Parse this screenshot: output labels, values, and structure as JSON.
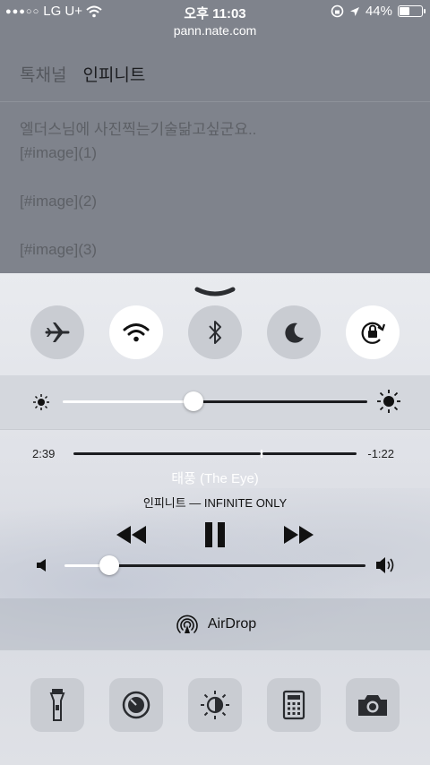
{
  "status_bar": {
    "carrier": "LG U+",
    "time": "오후 11:03",
    "battery_percent": "44%",
    "battery_level": 0.44
  },
  "browser": {
    "url": "pann.nate.com"
  },
  "background_page": {
    "nav": [
      "톡채널",
      "인피니트"
    ],
    "lines": [
      "엘더스님에 사진찍는기술닮고싶군요..",
      "[#image](1)",
      "[#image](2)",
      "[#image](3)"
    ]
  },
  "control_center": {
    "toggles": [
      {
        "icon": "airplane-icon",
        "on": false
      },
      {
        "icon": "wifi-icon",
        "on": true
      },
      {
        "icon": "bluetooth-icon",
        "on": false
      },
      {
        "icon": "moon-icon",
        "on": false
      },
      {
        "icon": "rotation-lock-icon",
        "on": true
      }
    ],
    "brightness_level": 0.43,
    "media": {
      "elapsed": "2:39",
      "remaining": "-1:22",
      "progress": 0.66,
      "title": "태풍 (The Eye)",
      "artist": "인피니트 — INFINITE ONLY",
      "volume_level": 0.15
    },
    "airdrop_label": "AirDrop",
    "shortcuts": [
      "flashlight-icon",
      "timer-icon",
      "night-shift-icon",
      "calculator-icon",
      "camera-icon"
    ]
  }
}
